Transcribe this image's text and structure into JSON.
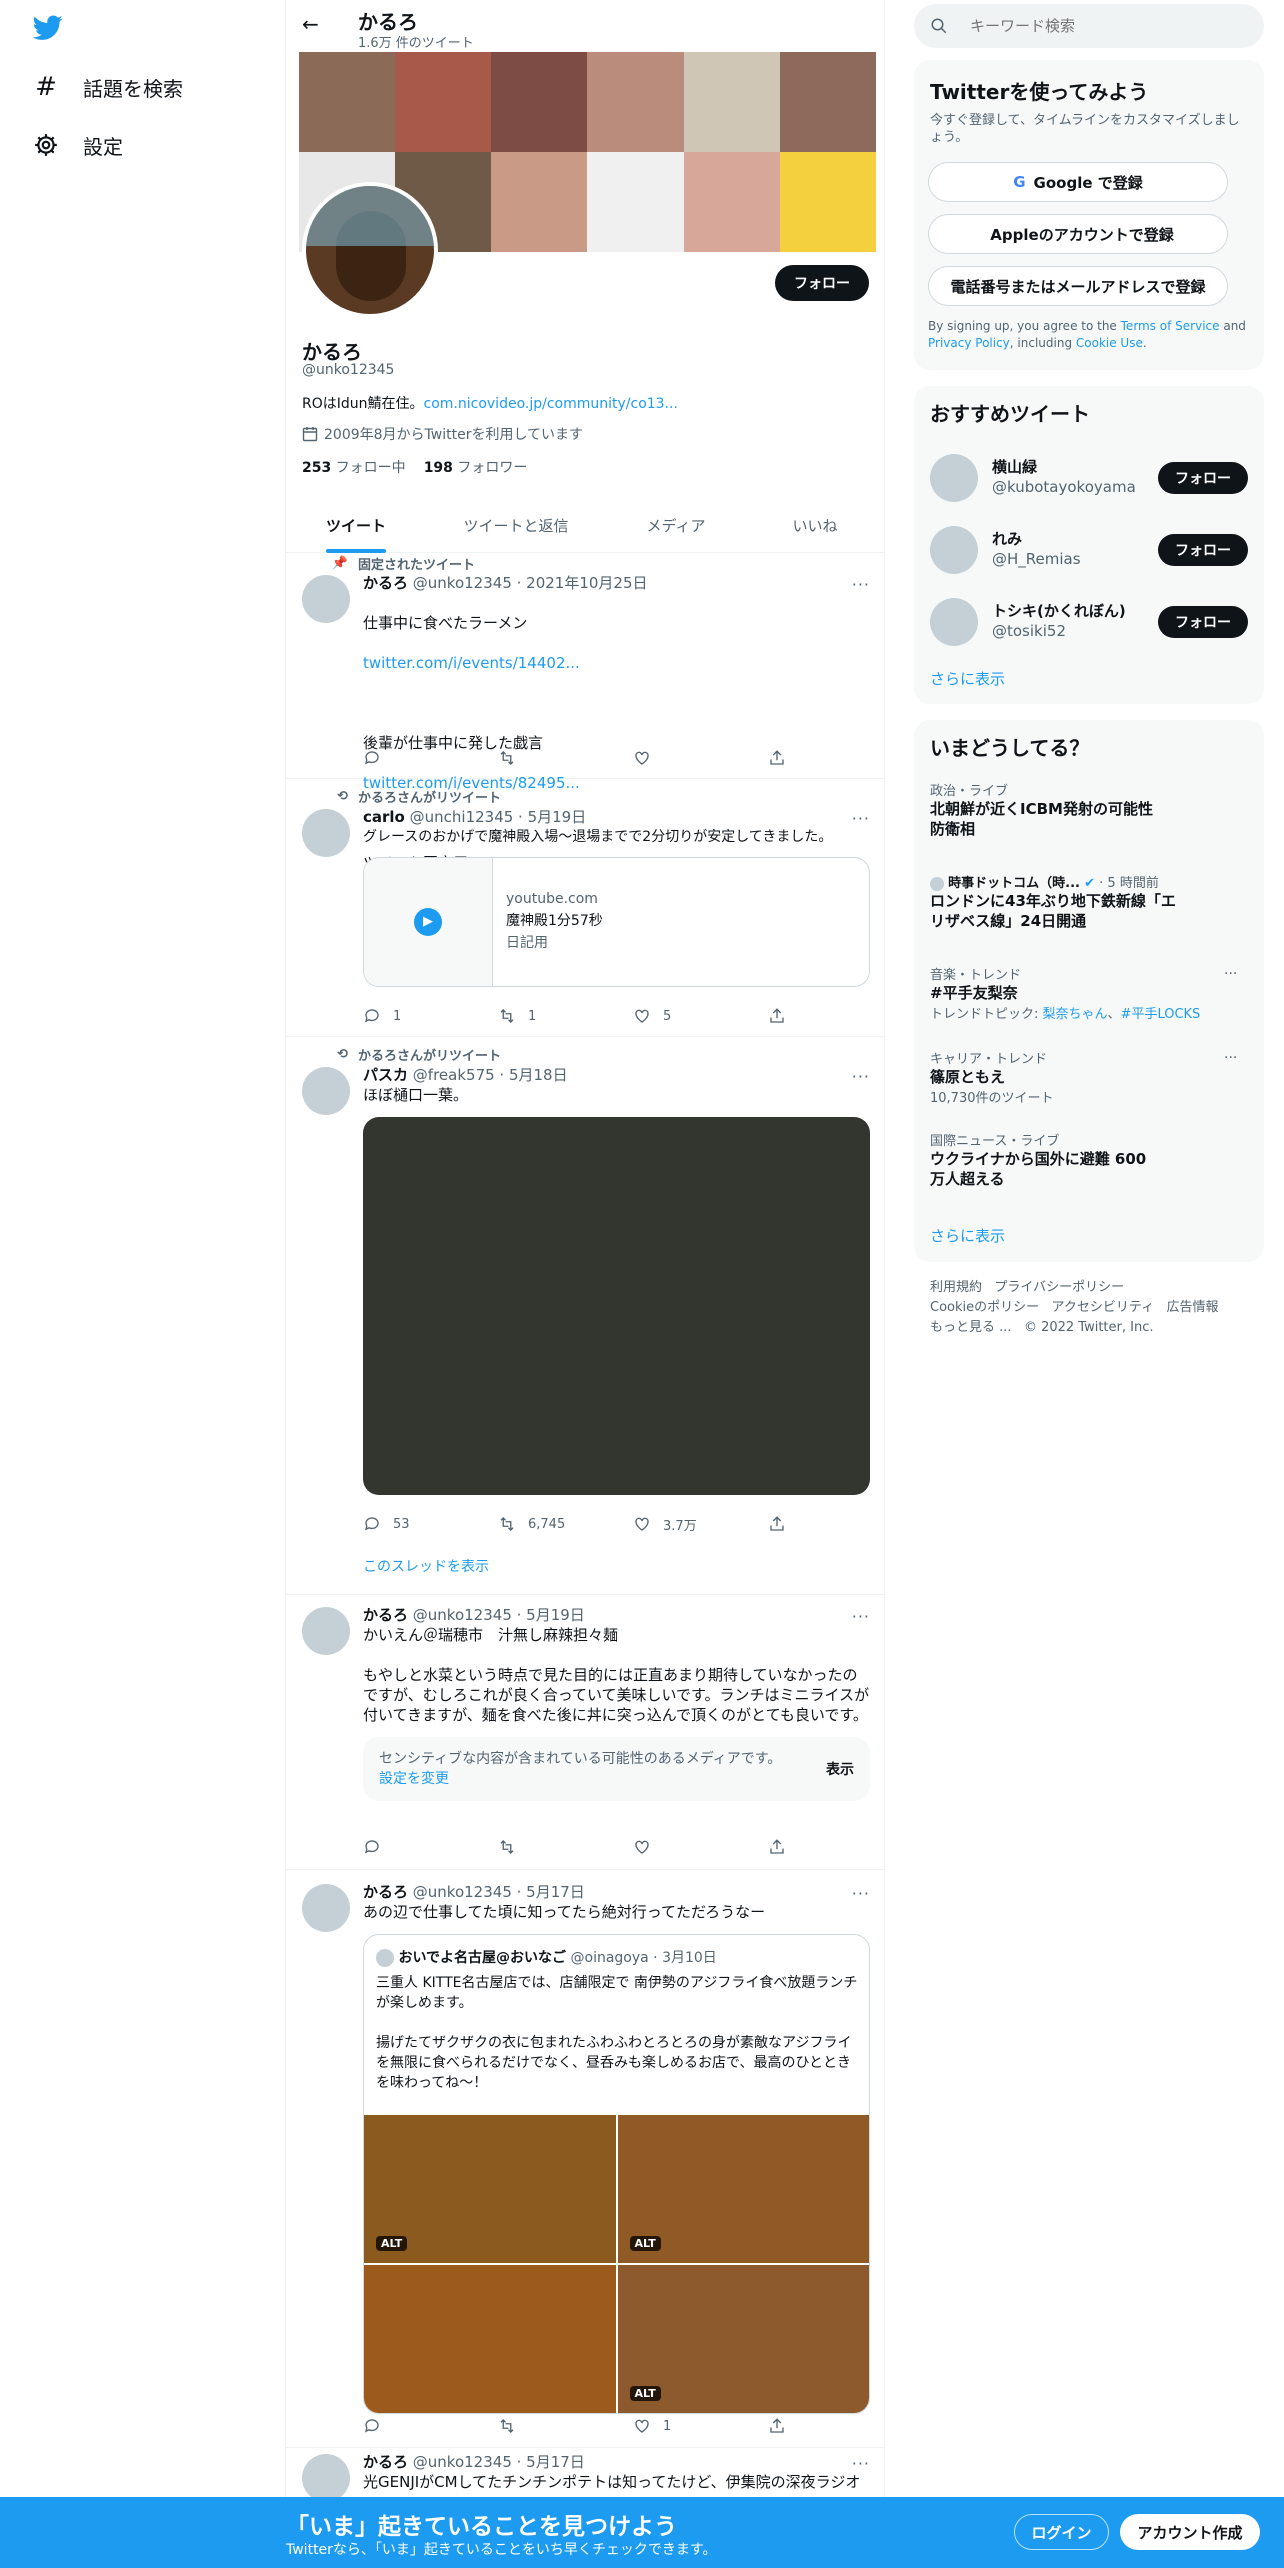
{
  "left_nav": {
    "explore_label": "話題を検索",
    "settings_label": "設定"
  },
  "header": {
    "name": "かるろ",
    "tweet_count": "1.6万 件のツイート"
  },
  "profile": {
    "name": "かるろ",
    "handle": "@unko12345",
    "bio_text": "ROはIdun鯖在住。",
    "bio_link": "com.nicovideo.jp/community/co13...",
    "joined": "2009年8月からTwitterを利用しています",
    "following_count": "253",
    "following_label": "フォロー中",
    "followers_count": "198",
    "followers_label": "フォロワー",
    "follow_button": "フォロー"
  },
  "tabs": [
    "ツイート",
    "ツイートと返信",
    "メディア",
    "いいね"
  ],
  "tweets": [
    {
      "context": "固定されたツイート",
      "name": "かるろ",
      "meta": "@unko12345 · 2021年10月25日",
      "line1": "仕事中に食べたラーメン",
      "link1": "twitter.com/i/events/14402...",
      "line2": "後輩が仕事中に発した戯言",
      "link2": "twitter.com/i/events/82495...",
      "line3": "ツイート固定用。"
    },
    {
      "context": "かるろさんがリツイート",
      "name": "carlo",
      "meta": "@unchi12345 · 5月19日",
      "text": "グレースのおかげで魔神殿入場～退場までで2分切りが安定してきました。",
      "card_domain": "youtube.com",
      "card_title": "魔神殿1分57秒",
      "card_desc": "日記用",
      "replies": "1",
      "retweets": "1",
      "likes": "5"
    },
    {
      "context": "かるろさんがリツイート",
      "name": "パスカ",
      "meta": "@freak575 · 5月18日",
      "text": "ほぼ樋口一葉。",
      "replies": "53",
      "retweets": "6,745",
      "likes": "3.7万",
      "thread_link": "このスレッドを表示"
    },
    {
      "name": "かるろ",
      "meta": "@unko12345 · 5月19日",
      "text": "かいえん＠瑞穂市　汁無し麻辣担々麺\n\nもやしと水菜という時点で見た目的には正直あまり期待していなかったのですが、むしろこれが良く合っていて美味しいです。ランチはミニライスが付いてきますが、麺を食べた後に丼に突っ込んで頂くのがとても良いです。",
      "sensitive_text": "センシティブな内容が含まれている可能性のあるメディアです。",
      "sensitive_link": "設定を変更",
      "show_label": "表示"
    },
    {
      "name": "かるろ",
      "meta": "@unko12345 · 5月17日",
      "text": "あの辺で仕事してた頃に知ってたら絶対行ってただろうなー",
      "quote_name": "おいでよ名古屋@おいなご",
      "quote_meta": "@oinagoya · 3月10日",
      "quote_text": "三重人 KITTE名古屋店では、店舗限定で 南伊勢のアジフライ食べ放題ランチが楽しめます。\n\n揚げたてザクザクの衣に包まれたふわふわとろとろの身が素敵なアジフライを無限に食べられるだけでなく、昼呑みも楽しめるお店で、最高のひとときを味わってね～！",
      "alt_label": "ALT",
      "likes": "1"
    },
    {
      "name": "かるろ",
      "meta": "@unko12345 · 5月17日",
      "text": "光GENJIがCMしてたチンチンポテトは知ってたけど、伊集院の深夜ラジオ"
    }
  ],
  "right": {
    "search_placeholder": "キーワード検索",
    "signup": {
      "title": "Twitterを使ってみよう",
      "subtitle": "今すぐ登録して、タイムラインをカスタマイズしましょう。",
      "google": "Google で登録",
      "apple": "Appleのアカウントで登録",
      "phone": "電話番号またはメールアドレスで登録",
      "terms_1": "By signing up, you agree to the ",
      "terms_link1": "Terms of Service",
      "terms_2": " and ",
      "terms_link2": "Privacy Policy",
      "terms_3": ", including ",
      "terms_link3": "Cookie Use",
      "terms_4": "."
    },
    "recommend": {
      "title": "おすすめツイート",
      "users": [
        {
          "name": "横山緑",
          "handle": "@kubotayokoyama"
        },
        {
          "name": "れみ",
          "handle": "@H_Remias"
        },
        {
          "name": "トシキ(かくれぼん)",
          "handle": "@tosiki52"
        }
      ],
      "follow": "フォロー",
      "more": "さらに表示"
    },
    "trends": {
      "title": "いまどうしてる？",
      "t1_cat": "政治・ライブ",
      "t1_name": "北朝鮮が近くICBM発射の可能性 防衛相",
      "t2_source": "時事ドットコム（時...",
      "t2_time": "· 5 時間前",
      "t2_name": "ロンドンに43年ぶり地下鉄新線「エリザベス線」24日開通",
      "t3_cat": "音楽・トレンド",
      "t3_name": "#平手友梨奈",
      "t3_topic_label": "トレンドトピック: ",
      "t3_topic1": "梨奈ちゃん",
      "t3_sep": "、",
      "t3_topic2": "#平手LOCKS",
      "t4_cat": "キャリア・トレンド",
      "t4_name": "篠原ともえ",
      "t4_count": "10,730件のツイート",
      "t5_cat": "国際ニュース・ライブ",
      "t5_name": "ウクライナから国外に避難 600万人超える",
      "more": "さらに表示"
    },
    "footer": {
      "terms": "利用規約",
      "privacy": "プライバシーポリシー",
      "cookie": "Cookieのポリシー",
      "accessibility": "アクセシビリティ",
      "ads": "広告情報",
      "more": "もっと見る ...",
      "copyright": "© 2022 Twitter, Inc."
    }
  },
  "bottom_bar": {
    "title": "「いま」起きていることを見つけよう",
    "subtitle": "Twitterなら、「いま」起きていることをいち早くチェックできます。",
    "login": "ログイン",
    "signup": "アカウント作成"
  },
  "colors": {
    "accent": "#1d9bf0",
    "text": "#0f1419",
    "secondary": "#536471",
    "card_bg": "#f7f9f9"
  }
}
